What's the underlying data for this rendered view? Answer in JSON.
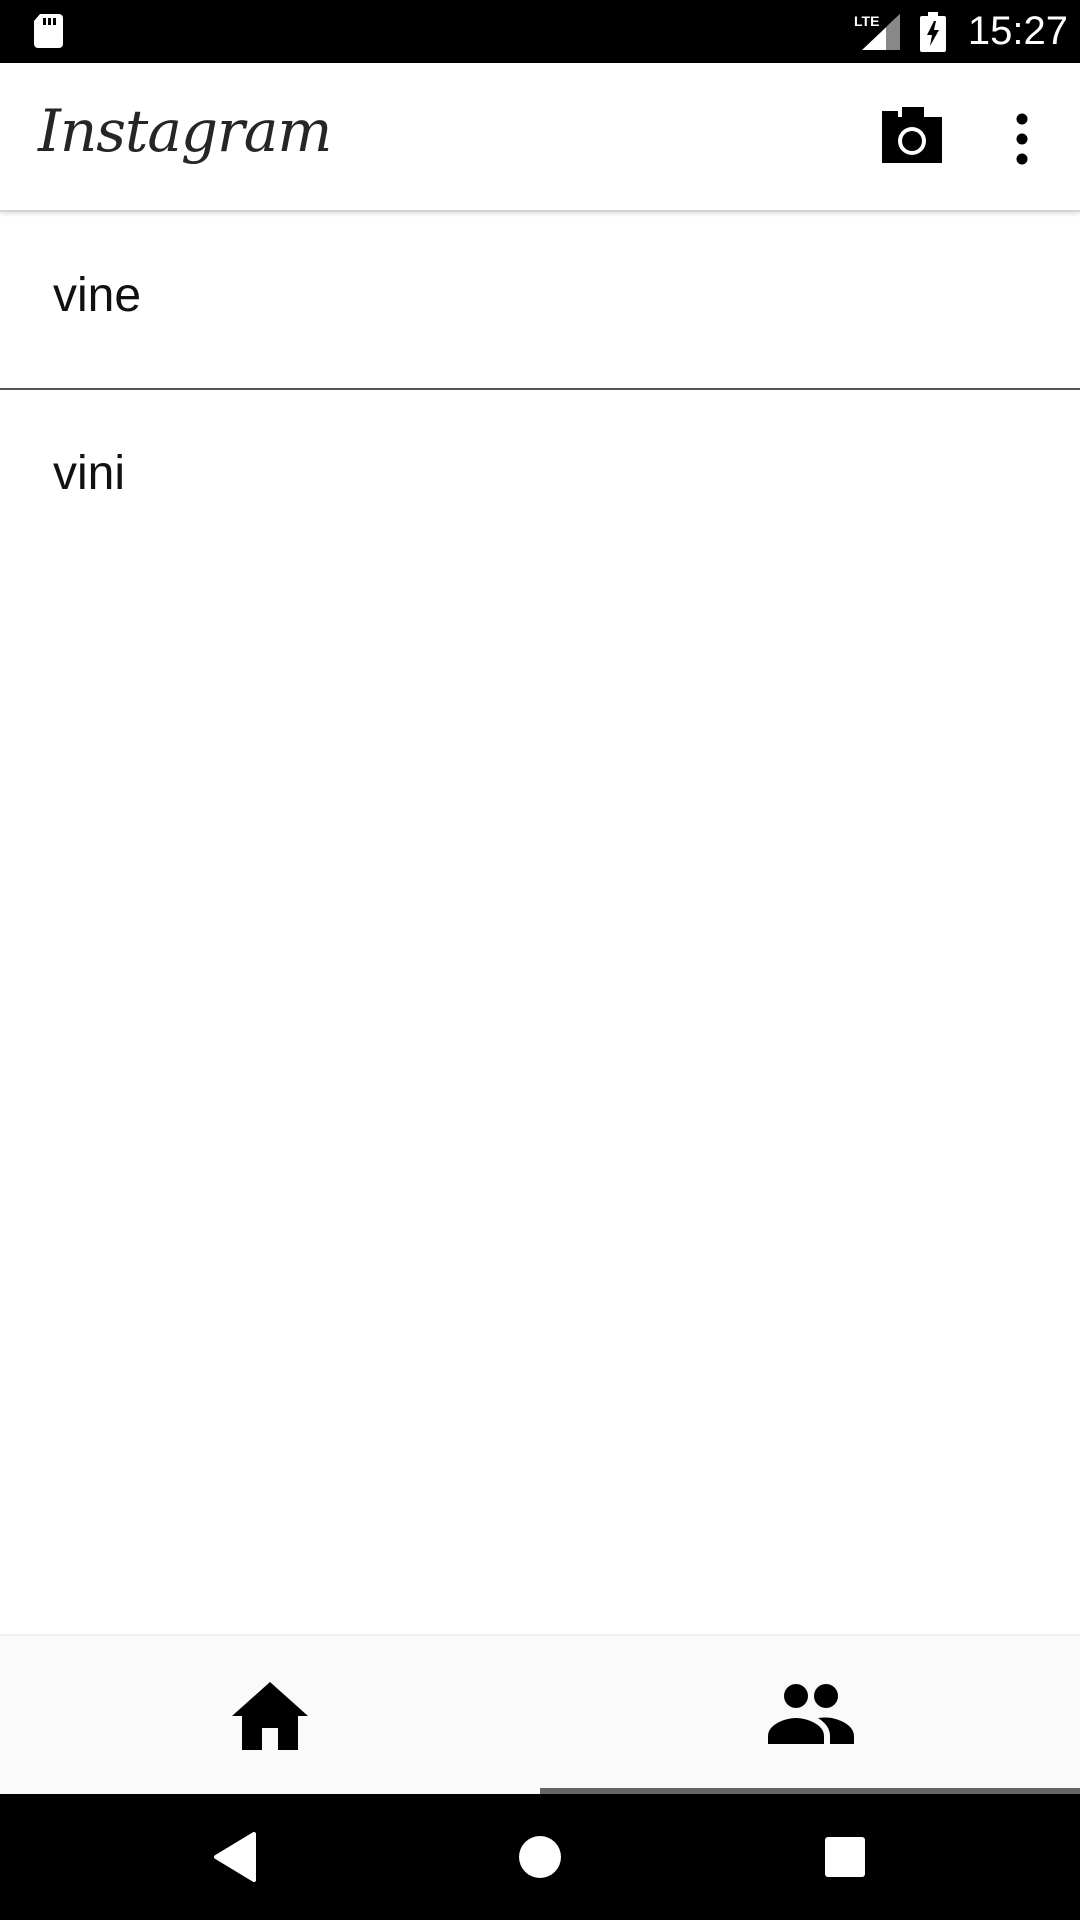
{
  "status_bar": {
    "time": "15:27",
    "network_label": "LTE",
    "icons": [
      "sd-card-icon",
      "lte-signal-icon",
      "battery-charging-icon"
    ]
  },
  "app_bar": {
    "logo": "Instagram",
    "actions": [
      "camera-icon",
      "more-vert-icon"
    ]
  },
  "list": {
    "items": [
      {
        "label": "vine"
      },
      {
        "label": "vini"
      }
    ]
  },
  "bottom_nav": {
    "tabs": [
      {
        "icon": "home-icon",
        "selected": false
      },
      {
        "icon": "people-icon",
        "selected": true
      }
    ],
    "indicator_color": "#666666"
  },
  "system_nav": {
    "buttons": [
      "back-icon",
      "home-circle-icon",
      "recents-icon"
    ]
  },
  "colors": {
    "status_bar_bg": "#000000",
    "app_bg": "#ffffff",
    "divider": "#555555",
    "bottom_nav_bg": "#fafafa"
  }
}
